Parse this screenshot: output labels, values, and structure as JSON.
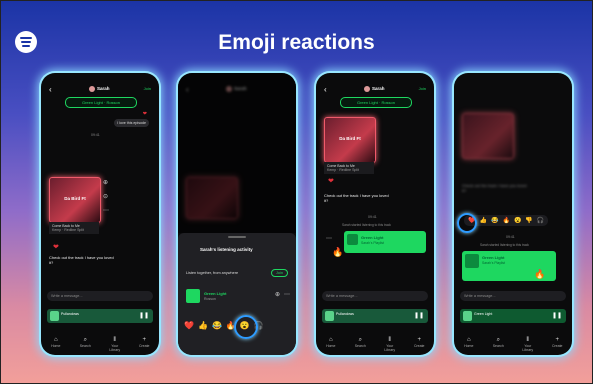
{
  "title": "Emoji reactions",
  "logo": "spotify-logo",
  "accent": "#1ed760",
  "chat": {
    "user": "Sarah",
    "join_label": "Join",
    "song_pill": "Green Light · Rosson",
    "reply_text": "I love this episode",
    "time_label": "09:41",
    "album_title": "Come Back to Me",
    "album_art_text": "Da Bird Ft",
    "album_artist": "Kemp · Redline Split",
    "message_text": "Check out the track I have you loved it?",
    "input_placeholder": "Write a message...",
    "now_playing": "Pullandows",
    "now_playing_sub": "Sarah Lee",
    "reaction_heart": "❤"
  },
  "sheet": {
    "title": "Sarah's listening activity",
    "subtitle": "Listen together, from anywhere",
    "join_label": "Join",
    "track": "Green Light",
    "artist": "Rosson"
  },
  "emojis": [
    "❤️",
    "👍",
    "😂",
    "🔥",
    "😮",
    "🎧"
  ],
  "emojis_short": [
    "❤️",
    "👍",
    "😂",
    "🔥",
    "😮",
    "👎",
    "🎧"
  ],
  "reaction_fire": "🔥",
  "card": {
    "caption": "Sarah started listening to this track",
    "track": "Green Light",
    "artist": "Sarah's Playlist"
  },
  "tabs": [
    "Home",
    "Search",
    "Your Library",
    "Create"
  ]
}
